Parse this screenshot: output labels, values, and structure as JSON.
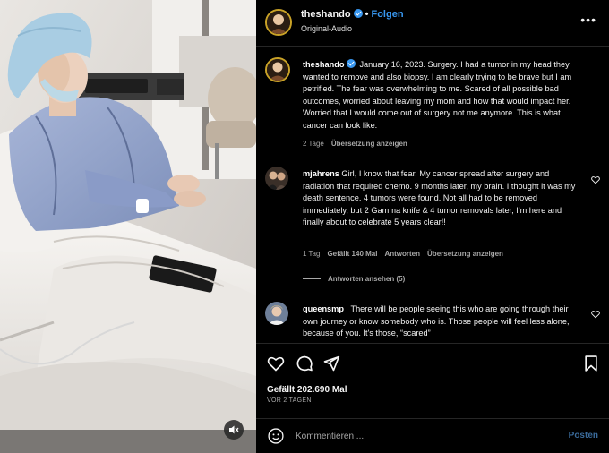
{
  "header": {
    "username": "theshando",
    "separator": "•",
    "follow_label": "Folgen",
    "audio_label": "Original-Audio",
    "more_label": "•••"
  },
  "caption": {
    "username": "theshando",
    "text": "January 16, 2023. Surgery. I had a tumor in my head they wanted to remove and also biopsy. I am clearly trying to be brave but I am petrified. The fear was overwhelming to me. Scared of all possible bad outcomes, worried about leaving my mom and how that would impact her. Worried that I would come out of surgery not me anymore. This is what cancer can look like.",
    "age": "2 Tage",
    "translate": "Übersetzung anzeigen"
  },
  "comments": [
    {
      "username": "mjahrens",
      "text": "Girl, I know that fear. My cancer spread after surgery and radiation that required chemo. 9 months later, my brain. I thought it was my death sentence. 4 tumors were found. Not all had to be removed immediately, but 2 Gamma knife & 4 tumor removals later, I'm here and finally about to celebrate 5 years clear!!",
      "age": "1 Tag",
      "likes": "Gefällt 140 Mal",
      "reply": "Antworten",
      "translate": "Übersetzung anzeigen",
      "view_replies": "Antworten ansehen (5)"
    },
    {
      "username": "queensmp_",
      "text": "There will be people seeing this who are going through their own journey or know somebody who is. Those people will feel less alone, because of you. It's those, “scared”"
    }
  ],
  "actions": {
    "likes": "Gefällt 202.690 Mal",
    "date": "VOR 2 TAGEN"
  },
  "comment_box": {
    "placeholder": "Kommentieren ...",
    "post_label": "Posten"
  },
  "icons": {
    "verified": "verified-badge-icon",
    "heart": "heart-icon",
    "comment": "comment-icon",
    "share": "paper-plane-icon",
    "save": "bookmark-icon",
    "emoji": "smiley-icon",
    "mute": "speaker-muted-icon"
  },
  "colors": {
    "background": "#000000",
    "link_blue": "#3897f0",
    "muted_text": "#a8a8a8",
    "divider": "#262626"
  }
}
